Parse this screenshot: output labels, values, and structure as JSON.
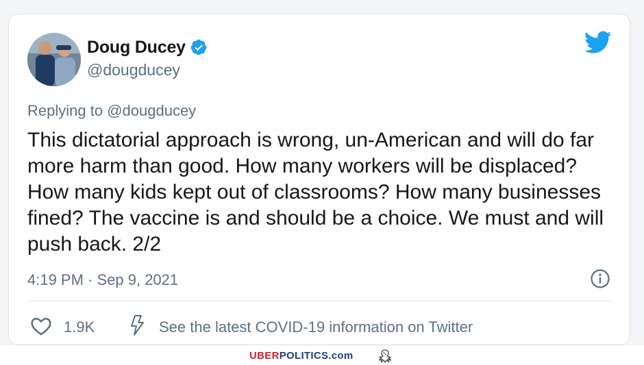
{
  "tweet": {
    "author_name": "Doug Ducey",
    "handle": "@dougducey",
    "verified": true,
    "reply_prefix": "Replying to",
    "reply_to": "@dougducey",
    "text": "This dictatorial approach is wrong, un-American and will do far more harm than good. How many workers will be displaced? How many kids kept out of classrooms? How many businesses fined? The vaccine is and should be a choice. We must and will push back. 2/2",
    "timestamp": "4:19 PM · Sep 9, 2021",
    "likes": "1.9K",
    "covid_notice": "See the latest COVID-19 information on Twitter"
  },
  "icons": {
    "verified": "verified-badge-icon",
    "brand": "twitter-bird-icon",
    "info": "info-icon",
    "like": "heart-icon",
    "covid": "lightning-icon",
    "watermark_logo": "eagle-icon"
  },
  "watermark": {
    "brand_red": "UBER",
    "brand_blue": "POLITICS.com"
  },
  "colors": {
    "twitter_blue": "#1da1f2",
    "text_primary": "#14171a",
    "text_secondary": "#5b7083",
    "brand_red": "#d8222a",
    "brand_blue": "#1d3d86"
  }
}
